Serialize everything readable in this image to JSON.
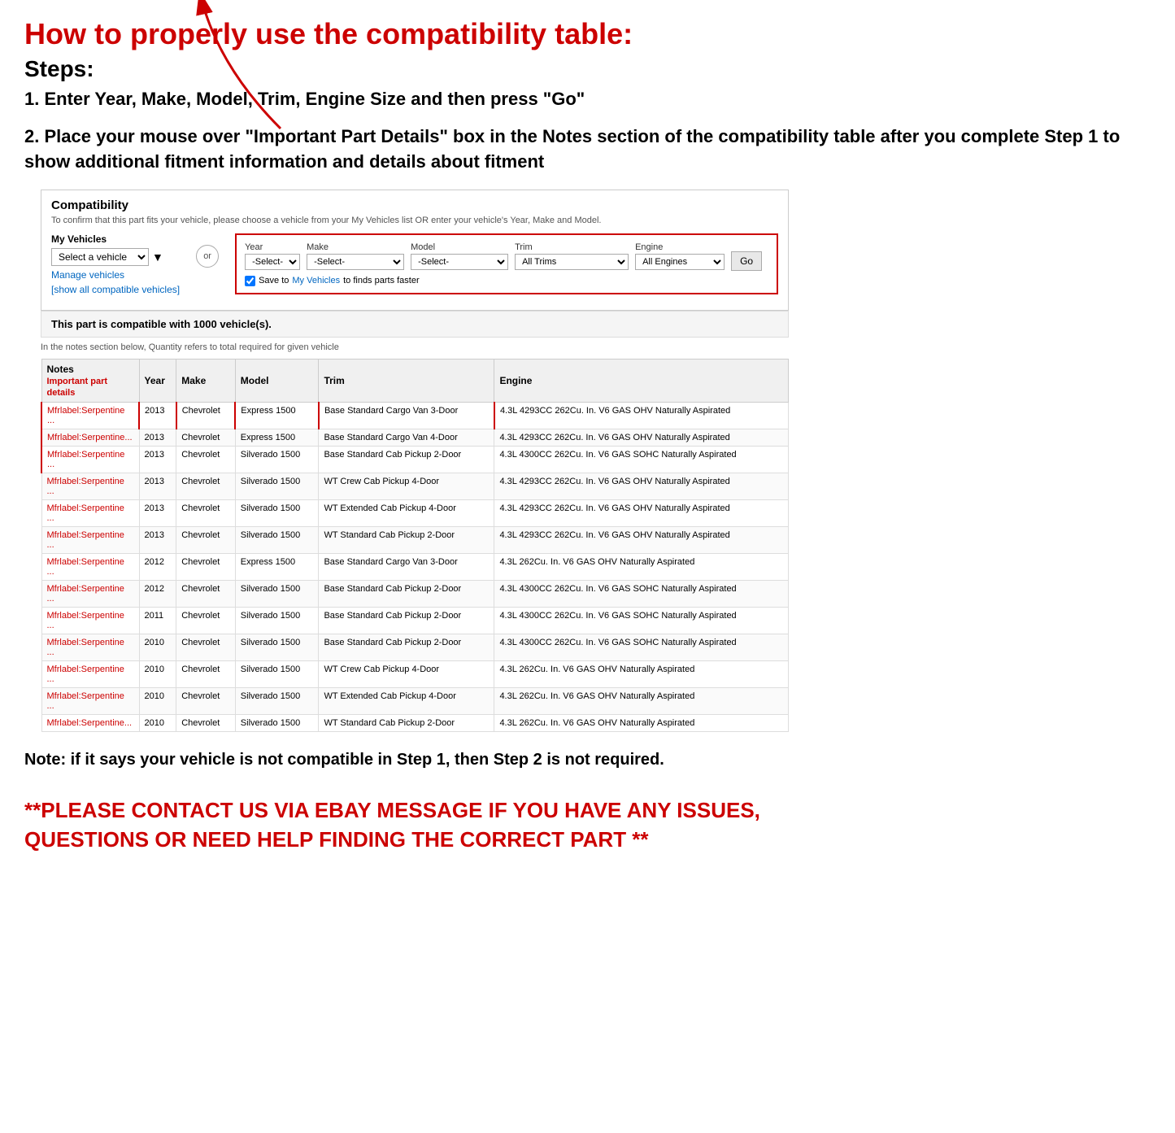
{
  "page": {
    "main_title": "How to properly use the compatibility table:",
    "steps_heading": "Steps:",
    "step1": "1. Enter Year, Make, Model, Trim, Engine Size and then press \"Go\"",
    "step2": "2. Place your mouse over \"Important Part Details\" box in the Notes section of the compatibility table after you complete Step 1 to show additional fitment information and details about fitment",
    "note": "Note: if it says your vehicle is not compatible in Step 1, then Step 2 is not required.",
    "contact": "**PLEASE CONTACT US VIA EBAY MESSAGE IF YOU HAVE ANY ISSUES, QUESTIONS OR NEED HELP FINDING THE CORRECT PART **"
  },
  "compatibility_widget": {
    "title": "Compatibility",
    "subtitle": "To confirm that this part fits your vehicle, please choose a vehicle from your My Vehicles list OR enter your vehicle's Year, Make and Model.",
    "my_vehicles_label": "My Vehicles",
    "select_vehicle_placeholder": "Select a vehicle",
    "manage_vehicles": "Manage vehicles",
    "show_all": "[show all compatible vehicles]",
    "or_label": "or",
    "year_label": "Year",
    "year_value": "-Select-",
    "make_label": "Make",
    "make_value": "-Select-",
    "model_label": "Model",
    "model_value": "-Select-",
    "trim_label": "Trim",
    "trim_value": "All Trims",
    "engine_label": "Engine",
    "engine_value": "All Engines",
    "go_button": "Go",
    "save_text": "Save to ",
    "save_link": "My Vehicles",
    "save_rest": " to finds parts faster",
    "compat_count": "This part is compatible with 1000 vehicle(s).",
    "quantity_note": "In the notes section below, Quantity refers to total required for given vehicle"
  },
  "table": {
    "headers": [
      "Notes",
      "Year",
      "Make",
      "Model",
      "Trim",
      "Engine"
    ],
    "notes_sub": "Important part details",
    "rows": [
      {
        "notes": "Mfrlabel:Serpentine ...",
        "year": "2013",
        "make": "Chevrolet",
        "model": "Express 1500",
        "trim": "Base Standard Cargo Van 3-Door",
        "engine": "4.3L 4293CC 262Cu. In. V6 GAS OHV Naturally Aspirated"
      },
      {
        "notes": "Mfrlabel:Serpentine...",
        "year": "2013",
        "make": "Chevrolet",
        "model": "Express 1500",
        "trim": "Base Standard Cargo Van 4-Door",
        "engine": "4.3L 4293CC 262Cu. In. V6 GAS OHV Naturally Aspirated"
      },
      {
        "notes": "Mfrlabel:Serpentine ...",
        "year": "2013",
        "make": "Chevrolet",
        "model": "Silverado 1500",
        "trim": "Base Standard Cab Pickup 2-Door",
        "engine": "4.3L 4300CC 262Cu. In. V6 GAS SOHC Naturally Aspirated"
      },
      {
        "notes": "Mfrlabel:Serpentine ...",
        "year": "2013",
        "make": "Chevrolet",
        "model": "Silverado 1500",
        "trim": "WT Crew Cab Pickup 4-Door",
        "engine": "4.3L 4293CC 262Cu. In. V6 GAS OHV Naturally Aspirated"
      },
      {
        "notes": "Mfrlabel:Serpentine ...",
        "year": "2013",
        "make": "Chevrolet",
        "model": "Silverado 1500",
        "trim": "WT Extended Cab Pickup 4-Door",
        "engine": "4.3L 4293CC 262Cu. In. V6 GAS OHV Naturally Aspirated"
      },
      {
        "notes": "Mfrlabel:Serpentine ...",
        "year": "2013",
        "make": "Chevrolet",
        "model": "Silverado 1500",
        "trim": "WT Standard Cab Pickup 2-Door",
        "engine": "4.3L 4293CC 262Cu. In. V6 GAS OHV Naturally Aspirated"
      },
      {
        "notes": "Mfrlabel:Serpentine ...",
        "year": "2012",
        "make": "Chevrolet",
        "model": "Express 1500",
        "trim": "Base Standard Cargo Van 3-Door",
        "engine": "4.3L 262Cu. In. V6 GAS OHV Naturally Aspirated"
      },
      {
        "notes": "Mfrlabel:Serpentine ...",
        "year": "2012",
        "make": "Chevrolet",
        "model": "Silverado 1500",
        "trim": "Base Standard Cab Pickup 2-Door",
        "engine": "4.3L 4300CC 262Cu. In. V6 GAS SOHC Naturally Aspirated"
      },
      {
        "notes": "Mfrlabel:Serpentine ...",
        "year": "2011",
        "make": "Chevrolet",
        "model": "Silverado 1500",
        "trim": "Base Standard Cab Pickup 2-Door",
        "engine": "4.3L 4300CC 262Cu. In. V6 GAS SOHC Naturally Aspirated"
      },
      {
        "notes": "Mfrlabel:Serpentine ...",
        "year": "2010",
        "make": "Chevrolet",
        "model": "Silverado 1500",
        "trim": "Base Standard Cab Pickup 2-Door",
        "engine": "4.3L 4300CC 262Cu. In. V6 GAS SOHC Naturally Aspirated"
      },
      {
        "notes": "Mfrlabel:Serpentine ...",
        "year": "2010",
        "make": "Chevrolet",
        "model": "Silverado 1500",
        "trim": "WT Crew Cab Pickup 4-Door",
        "engine": "4.3L 262Cu. In. V6 GAS OHV Naturally Aspirated"
      },
      {
        "notes": "Mfrlabel:Serpentine ...",
        "year": "2010",
        "make": "Chevrolet",
        "model": "Silverado 1500",
        "trim": "WT Extended Cab Pickup 4-Door",
        "engine": "4.3L 262Cu. In. V6 GAS OHV Naturally Aspirated"
      },
      {
        "notes": "Mfrlabel:Serpentine...",
        "year": "2010",
        "make": "Chevrolet",
        "model": "Silverado 1500",
        "trim": "WT Standard Cab Pickup 2-Door",
        "engine": "4.3L 262Cu. In. V6 GAS OHV Naturally Aspirated"
      }
    ]
  }
}
